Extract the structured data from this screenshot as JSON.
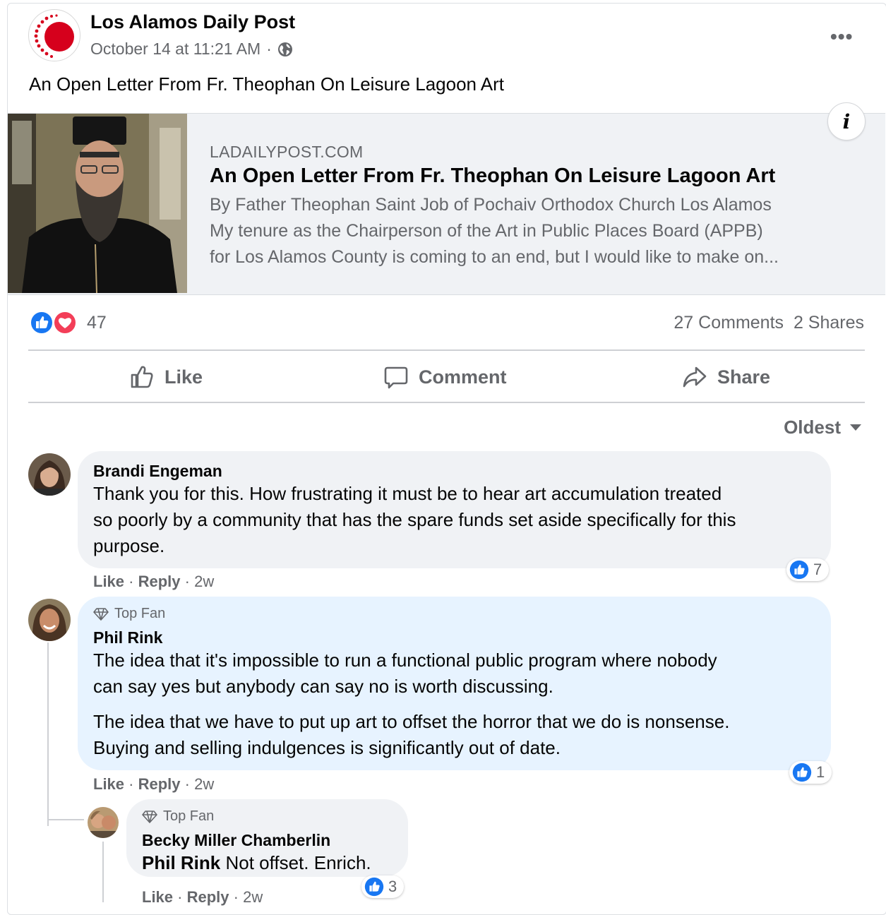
{
  "post": {
    "page_name": "Los Alamos Daily Post",
    "timestamp": "October 14 at 11:21 AM",
    "separator": "·",
    "privacy_icon": "globe-icon",
    "more_label": "•••",
    "text": "An Open Letter From Fr. Theophan On Leisure Lagoon Art"
  },
  "link_preview": {
    "domain": "LADAILYPOST.COM",
    "title": "An Open Letter From Fr. Theophan On Leisure Lagoon Art",
    "description_lines": [
      "By Father Theophan Saint Job of Pochaiv Orthodox Church Los Alamos",
      "My tenure as the Chairperson of the Art in Public Places Board (APPB)",
      "for Los Alamos County is coming to an end, but I would like to make on..."
    ],
    "info_label": "i"
  },
  "engagement": {
    "reaction_count": "47",
    "comments": "27 Comments",
    "shares": "2 Shares",
    "reaction_icons": [
      "like-icon",
      "love-icon"
    ]
  },
  "actions": {
    "like": "Like",
    "comment": "Comment",
    "share": "Share"
  },
  "sort": {
    "label": "Oldest"
  },
  "comments": [
    {
      "author": "Brandi Engeman",
      "lines": [
        "Thank you for this. How frustrating it must be to hear art accumulation treated",
        "so poorly by a community that has the spare funds set aside specifically for this",
        "purpose."
      ],
      "like": "Like",
      "reply": "Reply",
      "age": "2w",
      "likes": "7"
    },
    {
      "badge": "Top Fan",
      "author": "Phil Rink",
      "lines": [
        "The idea that it's impossible to run a functional public program where nobody",
        "can say yes but anybody can say no is worth discussing."
      ],
      "lines2": [
        "The idea that we have to put up art to offset the horror that we do is nonsense.",
        "Buying and selling indulgences is significantly out of date."
      ],
      "like": "Like",
      "reply": "Reply",
      "age": "2w",
      "likes": "1"
    },
    {
      "badge": "Top Fan",
      "author": "Becky Miller Chamberlin",
      "mention": "Phil Rink",
      "text": " Not offset. Enrich.",
      "like": "Like",
      "reply": "Reply",
      "age": "2w",
      "likes": "3"
    }
  ],
  "colors": {
    "brand_blue": "#1877f2",
    "love_red": "#f33e58",
    "secondary_text": "#65676b",
    "bubble_gray": "#f0f2f5",
    "bubble_blue": "#e7f3ff",
    "logo_red": "#d6001c"
  }
}
